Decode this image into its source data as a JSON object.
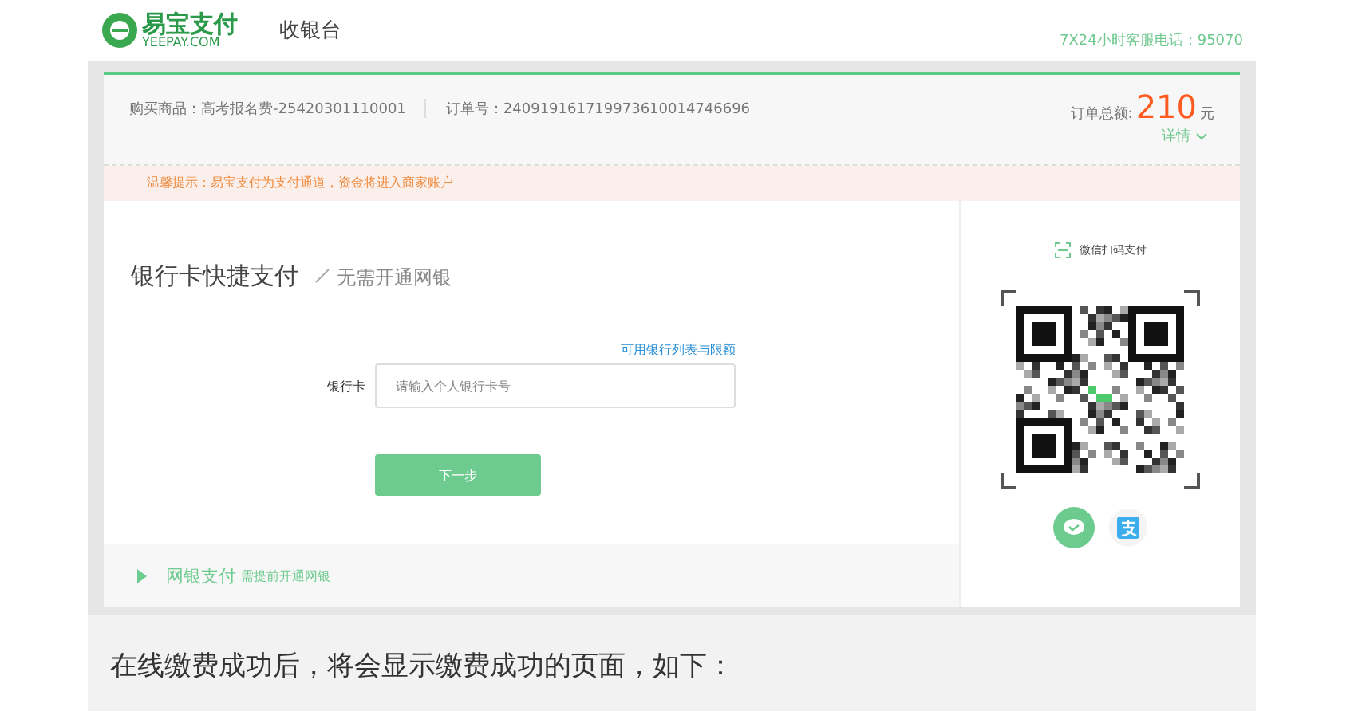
{
  "header": {
    "logo_text": "易宝支付",
    "logo_subtext": "YEEPAY.COM",
    "title": "收银台",
    "hotline": "7X24小时客服电话：95070"
  },
  "order": {
    "product": "购买商品：高考报名费-25420301110001",
    "order_no": "订单号：240919161719973610014746696",
    "total_label": "订单总额:",
    "total": "210",
    "unit": "元",
    "details": "详情",
    "details_expanded": false
  },
  "notice": "温馨提示：易宝支付为支付通道，资金将进入商家账户",
  "quick_pay": {
    "title": "银行卡快捷支付",
    "subtitle": "无需开通网银",
    "bank_list_link": "可用银行列表与限额",
    "card_label": "银行卡",
    "card_placeholder": "请输入个人银行卡号",
    "next_button": "下一步"
  },
  "online_bank": {
    "title": "网银支付",
    "hint": "需提前开通网银",
    "expanded": false
  },
  "scan": {
    "label": "微信扫码支付",
    "methods": [
      {
        "kind": "wechat",
        "selected": true
      },
      {
        "kind": "alipay",
        "selected": false
      }
    ]
  },
  "caption": "在线缴费成功后，将会显示缴费成功的页面，如下："
}
